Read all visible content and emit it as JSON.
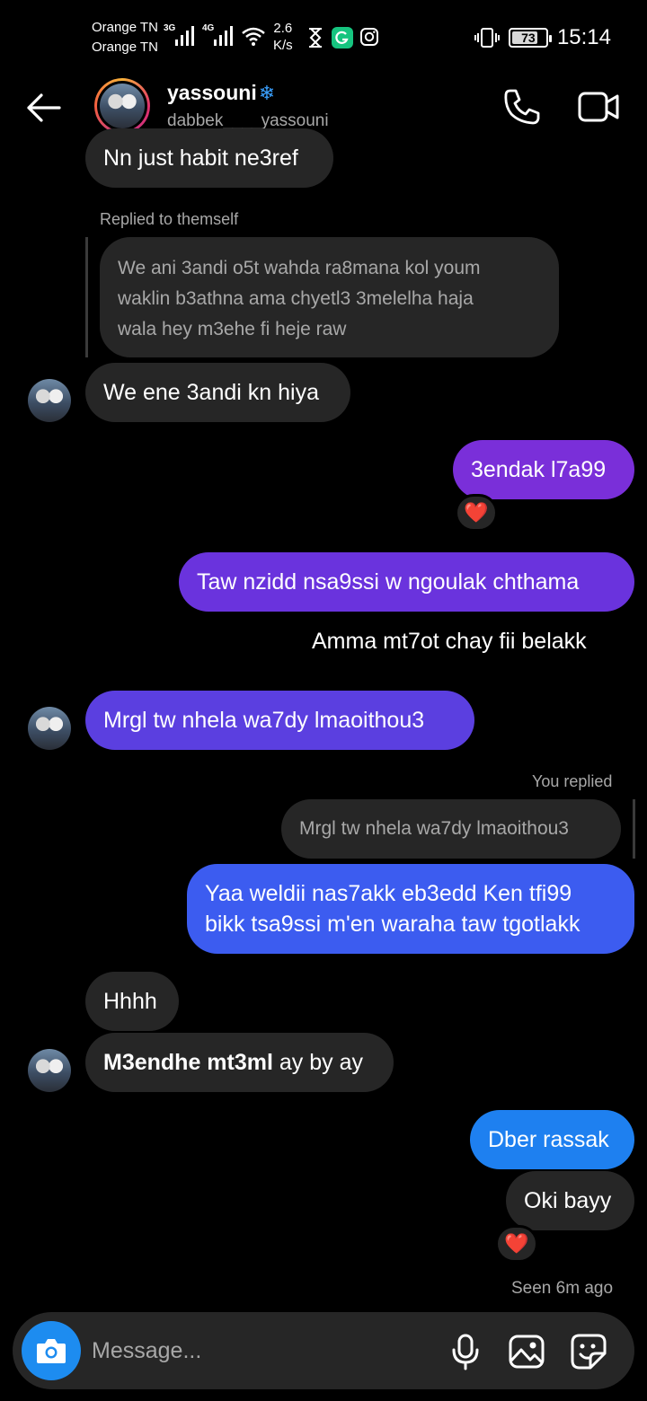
{
  "status_bar": {
    "carrier1": "Orange TN",
    "carrier2": "Orange TN",
    "net1": "3G",
    "net2": "4G",
    "speed_value": "2.6",
    "speed_unit": "K/s",
    "battery": "73",
    "time": "15:14"
  },
  "header": {
    "name": "yassouni",
    "name_badge": "❄",
    "username": "dabbek____yassouni"
  },
  "messages": {
    "m1": "Nn just habit ne3ref",
    "reply_label_1": "Replied to themself",
    "quote_1_line1": "We ani 3andi o5t wahda ra8mana kol youm",
    "quote_1_line2": "waklin b3athna ama chyetl3 3melelha haja",
    "quote_1_line3": "wala hey m3ehe fi heje raw",
    "m2": "We ene 3andi kn hiya",
    "m3": "3endak l7a99",
    "m3_reaction": "❤️",
    "m4": "Taw nzidd nsa9ssi w ngoulak chthama",
    "m5": "Amma mt7ot chay fii belakk",
    "m6": "Mrgl tw nhela wa7dy lmaoithou3",
    "reply_label_2": "You replied",
    "quote_2": "Mrgl tw nhela wa7dy lmaoithou3",
    "m7_line1": "Yaa weldii nas7akk eb3edd Ken tfi99",
    "m7_line2": "bikk tsa9ssi m'en waraha taw tgotlakk",
    "m8": "Hhhh",
    "m9_bold": "M3endhe mt3ml",
    "m9_rest": " ay by ay",
    "m10": "Dber rassak",
    "m11": "Oki bayy",
    "m11_reaction": "❤️",
    "seen": "Seen 6m ago"
  },
  "composer": {
    "placeholder": "Message..."
  },
  "colors": {
    "bubble_gray": "#262626",
    "sent_purple": "#7a2fd9",
    "sent_violet": "#5b3fe0",
    "sent_blue_violet": "#3c5cf0",
    "sent_blue": "#1e80f0",
    "camera_blue": "#1d8cf0"
  },
  "icons": {
    "back": "arrow-left-icon",
    "call": "phone-icon",
    "video": "video-camera-icon",
    "camera": "camera-icon",
    "mic": "microphone-icon",
    "gallery": "image-icon",
    "sticker": "sticker-icon"
  }
}
